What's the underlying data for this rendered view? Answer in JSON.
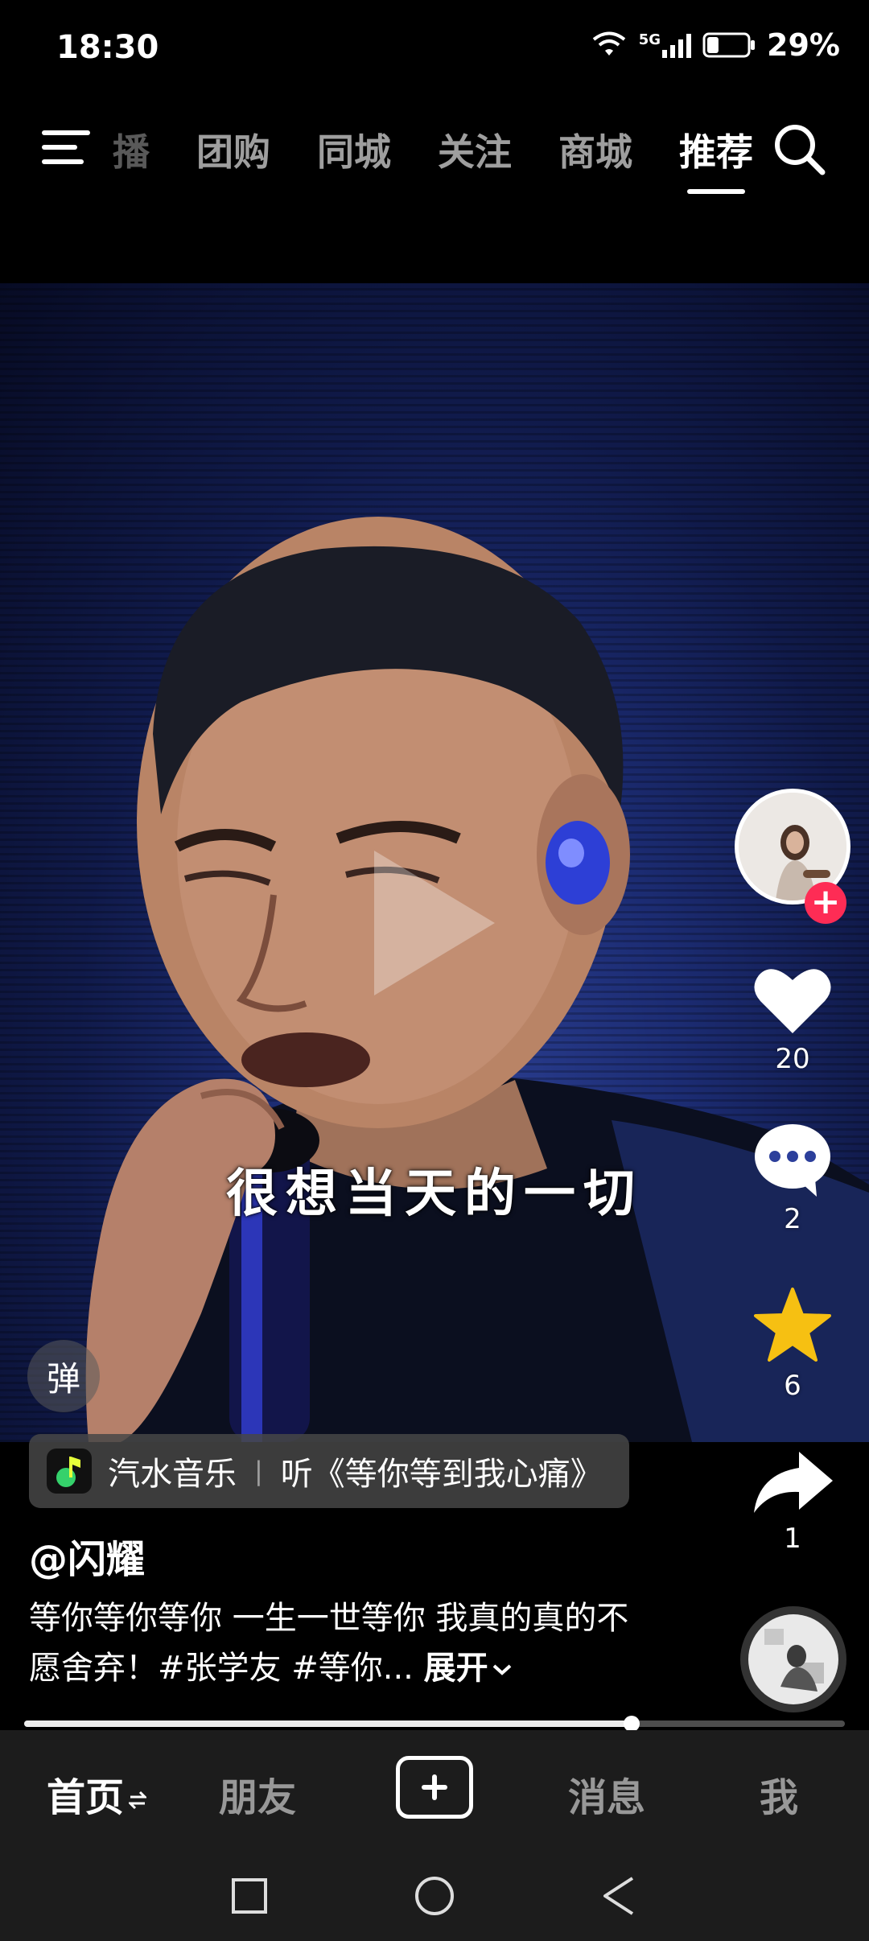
{
  "status_bar": {
    "time": "18:30",
    "network": "5G",
    "battery": "29%",
    "battery_level": 0.29
  },
  "top_nav": {
    "tabs": [
      {
        "label": "播"
      },
      {
        "label": "团购"
      },
      {
        "label": "同城"
      },
      {
        "label": "关注"
      },
      {
        "label": "商城"
      },
      {
        "label": "推荐"
      }
    ],
    "active_tab": "推荐",
    "icons": {
      "menu": "menu-icon",
      "search": "search-icon"
    }
  },
  "video": {
    "subtitle": "很想当天的一切",
    "danmu_label": "弹"
  },
  "side_actions": {
    "likes": "20",
    "comments": "2",
    "favorites": "6",
    "shares": "1"
  },
  "music": {
    "app": "汽水音乐",
    "prefix": "听",
    "song": "《等你等到我心痛》"
  },
  "post": {
    "author": "@闪耀",
    "caption": "等你等你等你 一生一世等你 我真的真的不愿舍弃！#张学友 #等你...",
    "expand_label": "展开"
  },
  "progress": {
    "fraction": 0.74
  },
  "bottom_nav": {
    "home": "首页",
    "friends": "朋友",
    "messages": "消息",
    "me": "我",
    "active": "首页"
  },
  "colors": {
    "follow": "#fe2c55",
    "favorite": "#f6c012",
    "background": "#000000"
  }
}
